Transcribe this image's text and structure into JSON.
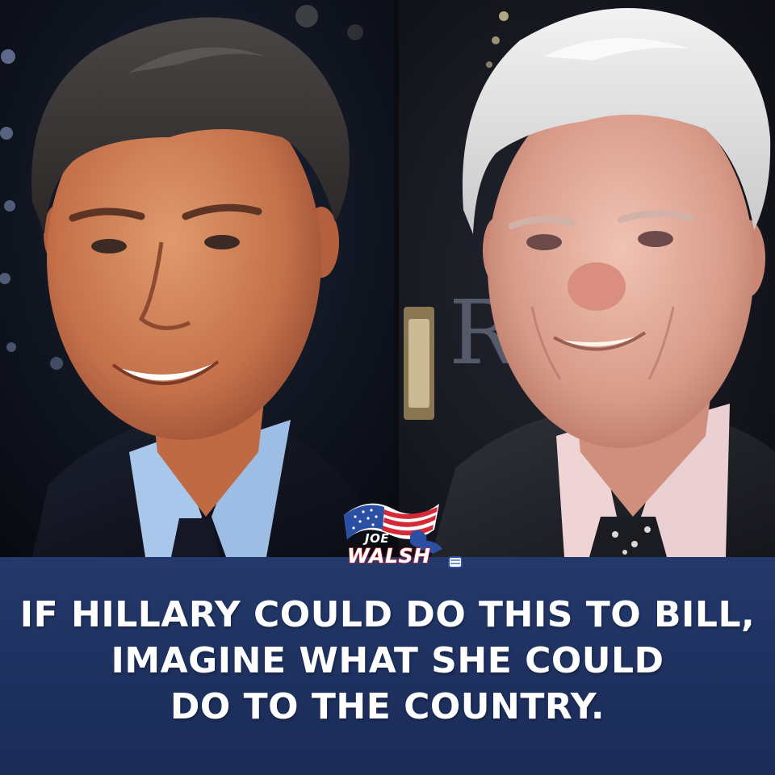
{
  "photos": {
    "left": {
      "subject": "younger man in dark suit, light blue shirt, dark tie"
    },
    "right": {
      "subject": "older man with white hair in dark suit, pink shirt, patterned tie"
    }
  },
  "logo": {
    "name_top": "JOE",
    "name_bottom": "WALSH",
    "colors": {
      "red": "#d42a37",
      "blue": "#2b4fa3",
      "white": "#ffffff"
    }
  },
  "caption": {
    "lines": [
      "IF HILLARY COULD DO THIS TO BILL,",
      "IMAGINE WHAT SHE COULD",
      "DO TO THE COUNTRY."
    ]
  },
  "colors": {
    "caption_background": "#1f3361",
    "caption_text": "#ffffff"
  }
}
